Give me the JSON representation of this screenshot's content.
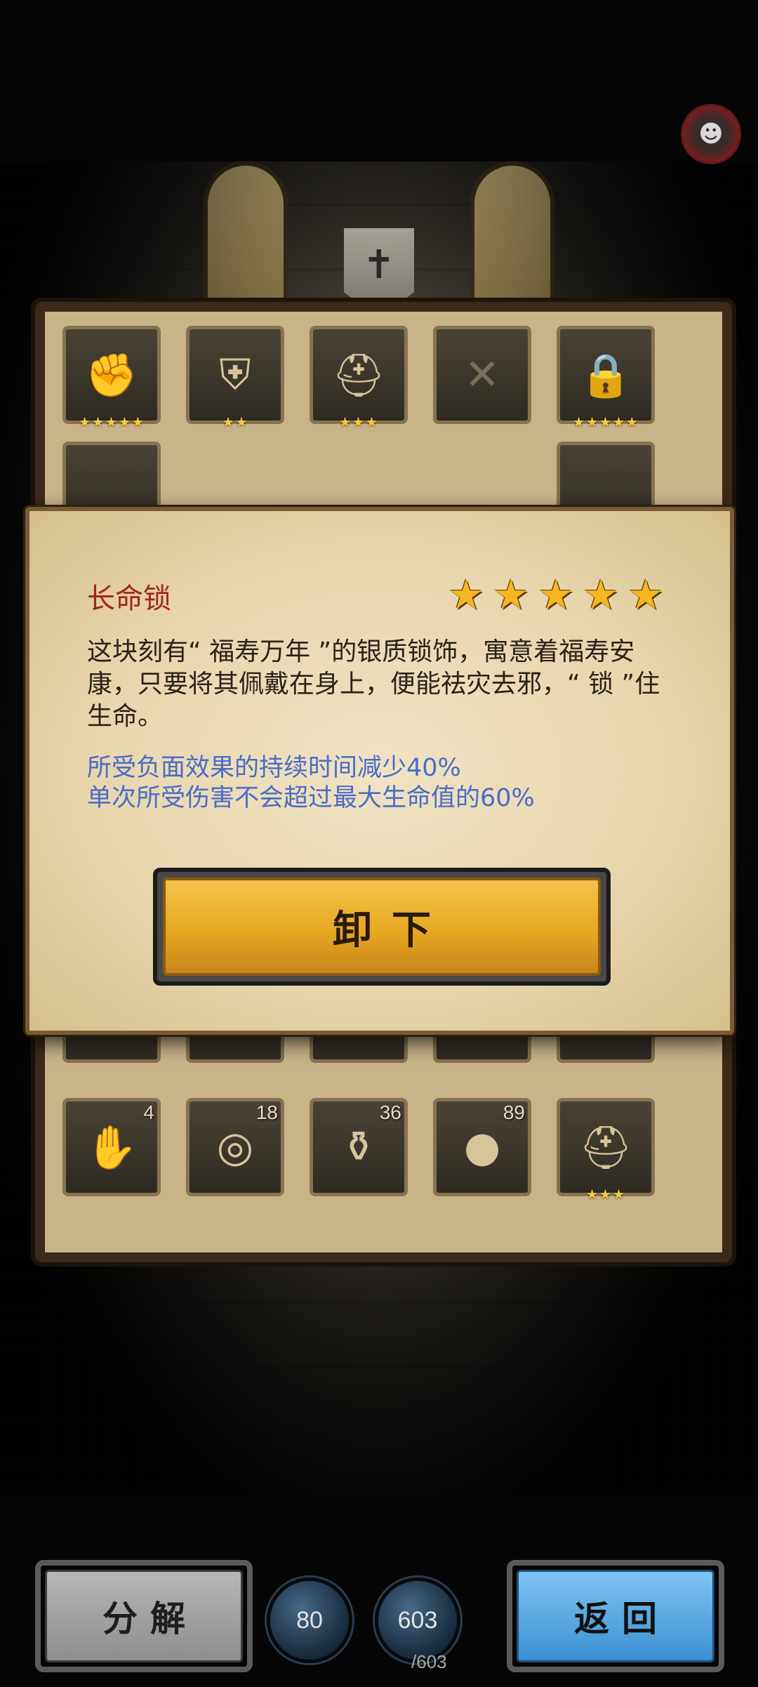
{
  "inventory": {
    "equipped_row": [
      {
        "icon": "gauntlet-icon",
        "stars": "★★★★★"
      },
      {
        "icon": "armor-icon",
        "stars": "★★"
      },
      {
        "icon": "spartan-helmet-icon",
        "stars": "★★★"
      },
      {
        "icon": "crossbow-icon",
        "stars": ""
      },
      {
        "icon": "longevity-lock-icon",
        "stars": "★★★★★"
      }
    ],
    "items_row": [
      {
        "icon": "buddha-hand-icon",
        "count": "4"
      },
      {
        "icon": "coin-icon",
        "count": "18"
      },
      {
        "icon": "vase-icon",
        "count": "36"
      },
      {
        "icon": "nut-icon",
        "count": "89"
      },
      {
        "icon": "spartan-helmet-icon",
        "stars": "★★★"
      }
    ]
  },
  "dialog": {
    "title": "长命锁",
    "star_count": 5,
    "description": "这块刻有“ 福寿万年 ”的银质锁饰，寓意着福寿安康，只要将其佩戴在身上，便能祛灾去邪，“ 锁 ”住生命。",
    "effects": [
      "所受负面效果的持续时间减少40%",
      "单次所受伤害不会超过最大生命值的60%"
    ],
    "unequip_label": "卸下"
  },
  "bottom_bar": {
    "decompose_label": "分解",
    "back_label": "返回",
    "orb1_value": "80",
    "orb2_value": "603",
    "orb2_max": "/603"
  }
}
